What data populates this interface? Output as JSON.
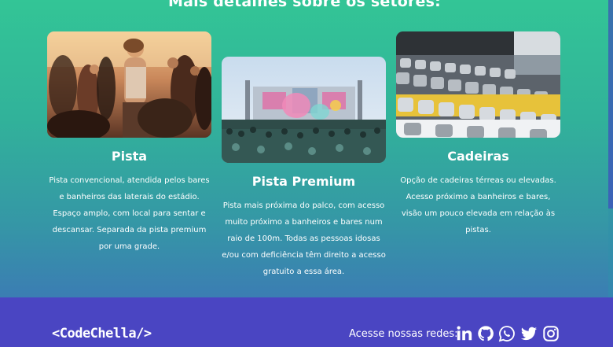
{
  "section": {
    "title": "Mais detalhes sobre os setores:"
  },
  "cards": [
    {
      "title": "Pista",
      "description": "Pista convencional, atendida pelos bares e banheiros das laterais do estádio. Espaço amplo, com local para sentar e descansar. Separada da pista premium por uma grade.",
      "image": "festival-crowd-photo"
    },
    {
      "title": "Pista Premium",
      "description": "Pista mais próxima do palco, com acesso muito próximo a banheiros e bares num raio de 100m. Todas as pessoas idosas e/ou com deficiência têm direito a acesso gratuito a essa área.",
      "image": "stage-crowd-photo"
    },
    {
      "title": "Cadeiras",
      "description": "Opção de cadeiras térreas ou elevadas. Acesso próximo a banheiros e bares, visão um pouco elevada em relação às pistas.",
      "image": "stadium-seats-photo"
    }
  ],
  "footer": {
    "logo": "<CodeChella/>",
    "social_label": "Acesse nossas redes:",
    "social_icons": [
      "linkedin-icon",
      "github-icon",
      "whatsapp-icon",
      "twitter-icon",
      "instagram-icon"
    ]
  },
  "colors": {
    "gradient_top": "#33c596",
    "gradient_bottom": "#3b7db3",
    "footer_bg": "#4a45c2",
    "text": "#ffffff"
  }
}
